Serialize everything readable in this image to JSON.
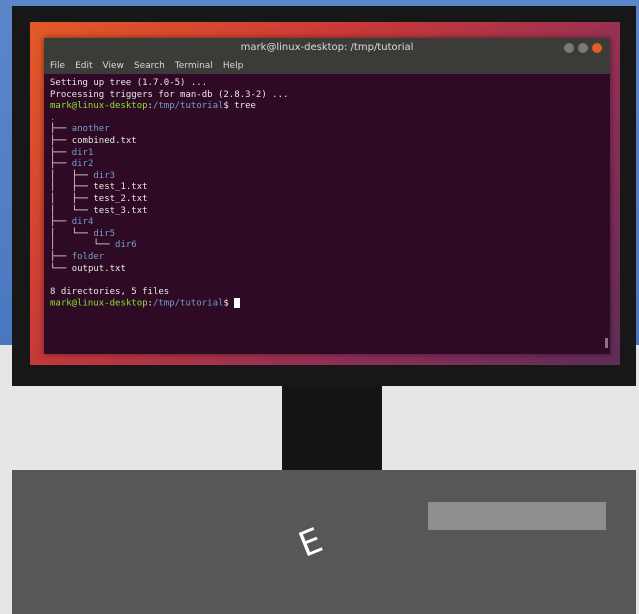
{
  "window": {
    "title": "mark@linux-desktop: /tmp/tutorial"
  },
  "menu": [
    "File",
    "Edit",
    "View",
    "Search",
    "Terminal",
    "Help"
  ],
  "terminal": {
    "lines": [
      {
        "parts": [
          {
            "t": "Setting up tree (1.7.0-5) ...",
            "c": "file"
          }
        ]
      },
      {
        "parts": [
          {
            "t": "Processing triggers for man-db (2.8.3-2) ...",
            "c": "file"
          }
        ]
      },
      {
        "parts": [
          {
            "t": "mark@linux-desktop",
            "c": "prompt-user"
          },
          {
            "t": ":",
            "c": "file"
          },
          {
            "t": "/tmp/tutorial",
            "c": "prompt-path"
          },
          {
            "t": "$ tree",
            "c": "file"
          }
        ]
      },
      {
        "parts": [
          {
            "t": ".",
            "c": "dir"
          }
        ]
      },
      {
        "parts": [
          {
            "t": "├── ",
            "c": "file"
          },
          {
            "t": "another",
            "c": "dir"
          }
        ]
      },
      {
        "parts": [
          {
            "t": "├── ",
            "c": "file"
          },
          {
            "t": "combined.txt",
            "c": "file"
          }
        ]
      },
      {
        "parts": [
          {
            "t": "├── ",
            "c": "file"
          },
          {
            "t": "dir1",
            "c": "dir"
          }
        ]
      },
      {
        "parts": [
          {
            "t": "├── ",
            "c": "file"
          },
          {
            "t": "dir2",
            "c": "dir"
          }
        ]
      },
      {
        "parts": [
          {
            "t": "│   ├── ",
            "c": "file"
          },
          {
            "t": "dir3",
            "c": "dir"
          }
        ]
      },
      {
        "parts": [
          {
            "t": "│   ├── ",
            "c": "file"
          },
          {
            "t": "test_1.txt",
            "c": "file"
          }
        ]
      },
      {
        "parts": [
          {
            "t": "│   ├── ",
            "c": "file"
          },
          {
            "t": "test_2.txt",
            "c": "file"
          }
        ]
      },
      {
        "parts": [
          {
            "t": "│   └── ",
            "c": "file"
          },
          {
            "t": "test_3.txt",
            "c": "file"
          }
        ]
      },
      {
        "parts": [
          {
            "t": "├── ",
            "c": "file"
          },
          {
            "t": "dir4",
            "c": "dir"
          }
        ]
      },
      {
        "parts": [
          {
            "t": "│   └── ",
            "c": "file"
          },
          {
            "t": "dir5",
            "c": "dir"
          }
        ]
      },
      {
        "parts": [
          {
            "t": "│       └── ",
            "c": "file"
          },
          {
            "t": "dir6",
            "c": "dir"
          }
        ]
      },
      {
        "parts": [
          {
            "t": "├── ",
            "c": "file"
          },
          {
            "t": "folder",
            "c": "dir"
          }
        ]
      },
      {
        "parts": [
          {
            "t": "└── ",
            "c": "file"
          },
          {
            "t": "output.txt",
            "c": "file"
          }
        ]
      },
      {
        "parts": [
          {
            "t": "",
            "c": "file"
          }
        ]
      },
      {
        "parts": [
          {
            "t": "8 directories, 5 files",
            "c": "file"
          }
        ]
      },
      {
        "parts": [
          {
            "t": "mark@linux-desktop",
            "c": "prompt-user"
          },
          {
            "t": ":",
            "c": "file"
          },
          {
            "t": "/tmp/tutorial",
            "c": "prompt-path"
          },
          {
            "t": "$ ",
            "c": "file"
          }
        ],
        "cursor": true
      }
    ]
  },
  "base": {
    "letter": "E"
  },
  "colors": {
    "terminal_bg": "#2f0a24",
    "prompt_user": "#8ae234",
    "directory": "#729fcf",
    "close_button": "#e25c25"
  }
}
